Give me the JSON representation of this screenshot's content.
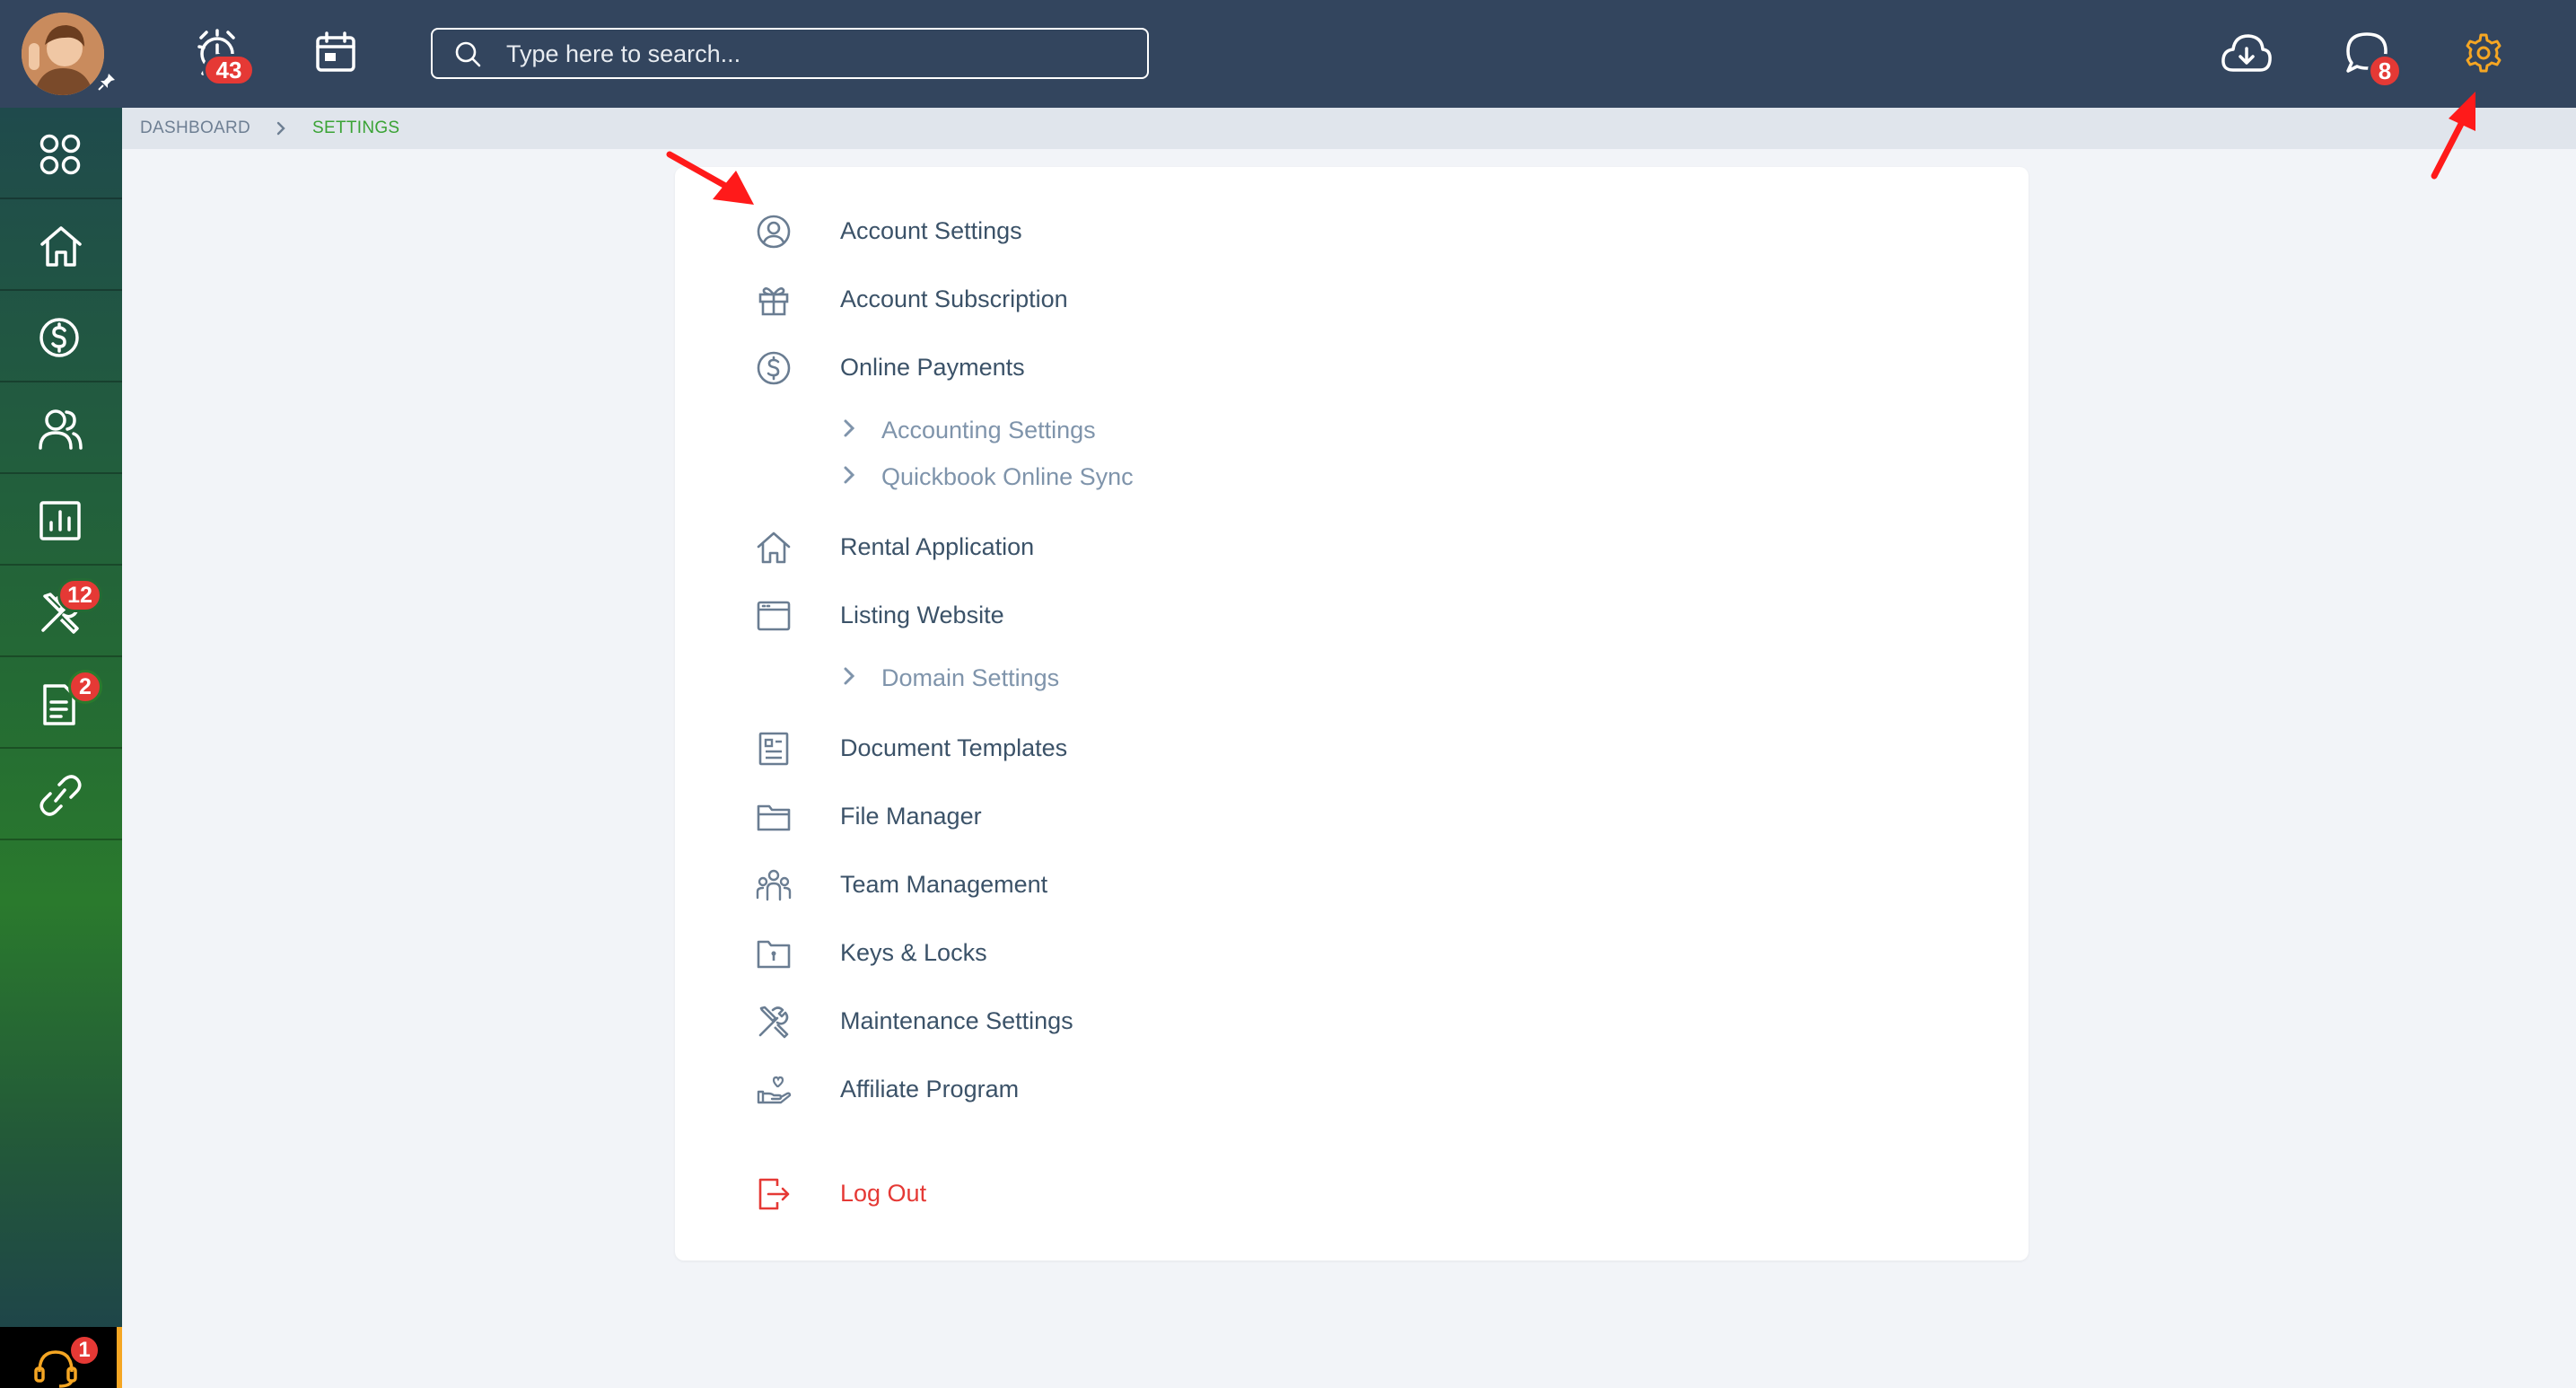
{
  "header": {
    "alarm_badge": "43",
    "search_placeholder": "Type here to search...",
    "messages_badge": "8"
  },
  "sidebar": {
    "items": [
      {
        "icon": "apps-grid-icon"
      },
      {
        "icon": "home-icon"
      },
      {
        "icon": "dollar-icon"
      },
      {
        "icon": "users-icon"
      },
      {
        "icon": "reports-icon"
      },
      {
        "icon": "maintenance-tools-icon",
        "badge": "12"
      },
      {
        "icon": "document-icon",
        "badge": "2"
      },
      {
        "icon": "link-icon"
      }
    ],
    "support_badge": "1"
  },
  "breadcrumb": {
    "root": "DASHBOARD",
    "current": "SETTINGS"
  },
  "settings_menu": {
    "account_settings": "Account Settings",
    "account_subscription": "Account Subscription",
    "online_payments": "Online Payments",
    "accounting_settings": "Accounting Settings",
    "quickbook_sync": "Quickbook Online Sync",
    "rental_application": "Rental Application",
    "listing_website": "Listing Website",
    "domain_settings": "Domain Settings",
    "document_templates": "Document Templates",
    "file_manager": "File Manager",
    "team_management": "Team Management",
    "keys_locks": "Keys & Locks",
    "maintenance_settings": "Maintenance Settings",
    "affiliate_program": "Affiliate Program",
    "log_out": "Log Out"
  },
  "colors": {
    "topbar": "#33455e",
    "accent_gear": "#f5a623",
    "breadcrumb_active": "#3aa335",
    "logout": "#e53935",
    "badge": "#e53935"
  }
}
